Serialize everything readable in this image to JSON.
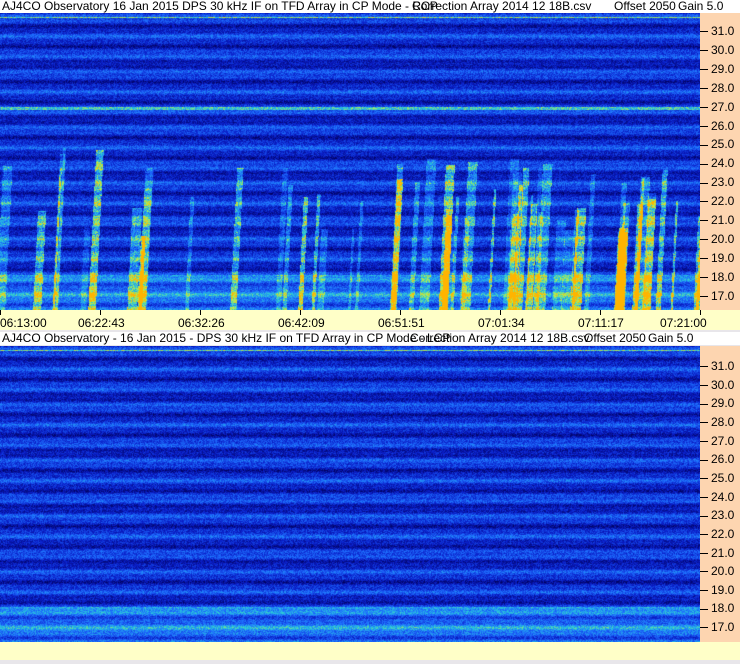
{
  "top_panel": {
    "title": {
      "observatory": "AJ4CO Observatory   16 Jan 2015   DPS 30 kHz IF on TFD Array in CP Mode - RCP",
      "correction": "Correction Array 2014 12 18B.csv",
      "offset": "Offset 2050",
      "gain": "Gain 5.0"
    },
    "y_ticks": [
      "31.0",
      "30.0",
      "29.0",
      "28.0",
      "27.0",
      "26.0",
      "25.0",
      "24.0",
      "23.0",
      "22.0",
      "21.0",
      "20.0",
      "19.0",
      "18.0",
      "17.0"
    ]
  },
  "time_axis": {
    "ticks": [
      "06:13:00",
      "06:22:43",
      "06:32:26",
      "06:42:09",
      "06:51:51",
      "07:01:34",
      "07:11:17",
      "07:21:00"
    ]
  },
  "bottom_panel": {
    "title": {
      "observatory": "AJ4CO Observatory - 16 Jan 2015 - DPS 30 kHz IF on TFD Array in CP Mode - LCP",
      "correction": "Correction Array 2014 12 18B.csv",
      "offset": "Offset 2050",
      "gain": "Gain 5.0"
    },
    "y_ticks": [
      "31.0",
      "30.0",
      "29.0",
      "28.0",
      "27.0",
      "26.0",
      "25.0",
      "24.0",
      "23.0",
      "22.0",
      "21.0",
      "20.0",
      "19.0",
      "18.0",
      "17.0"
    ]
  }
}
